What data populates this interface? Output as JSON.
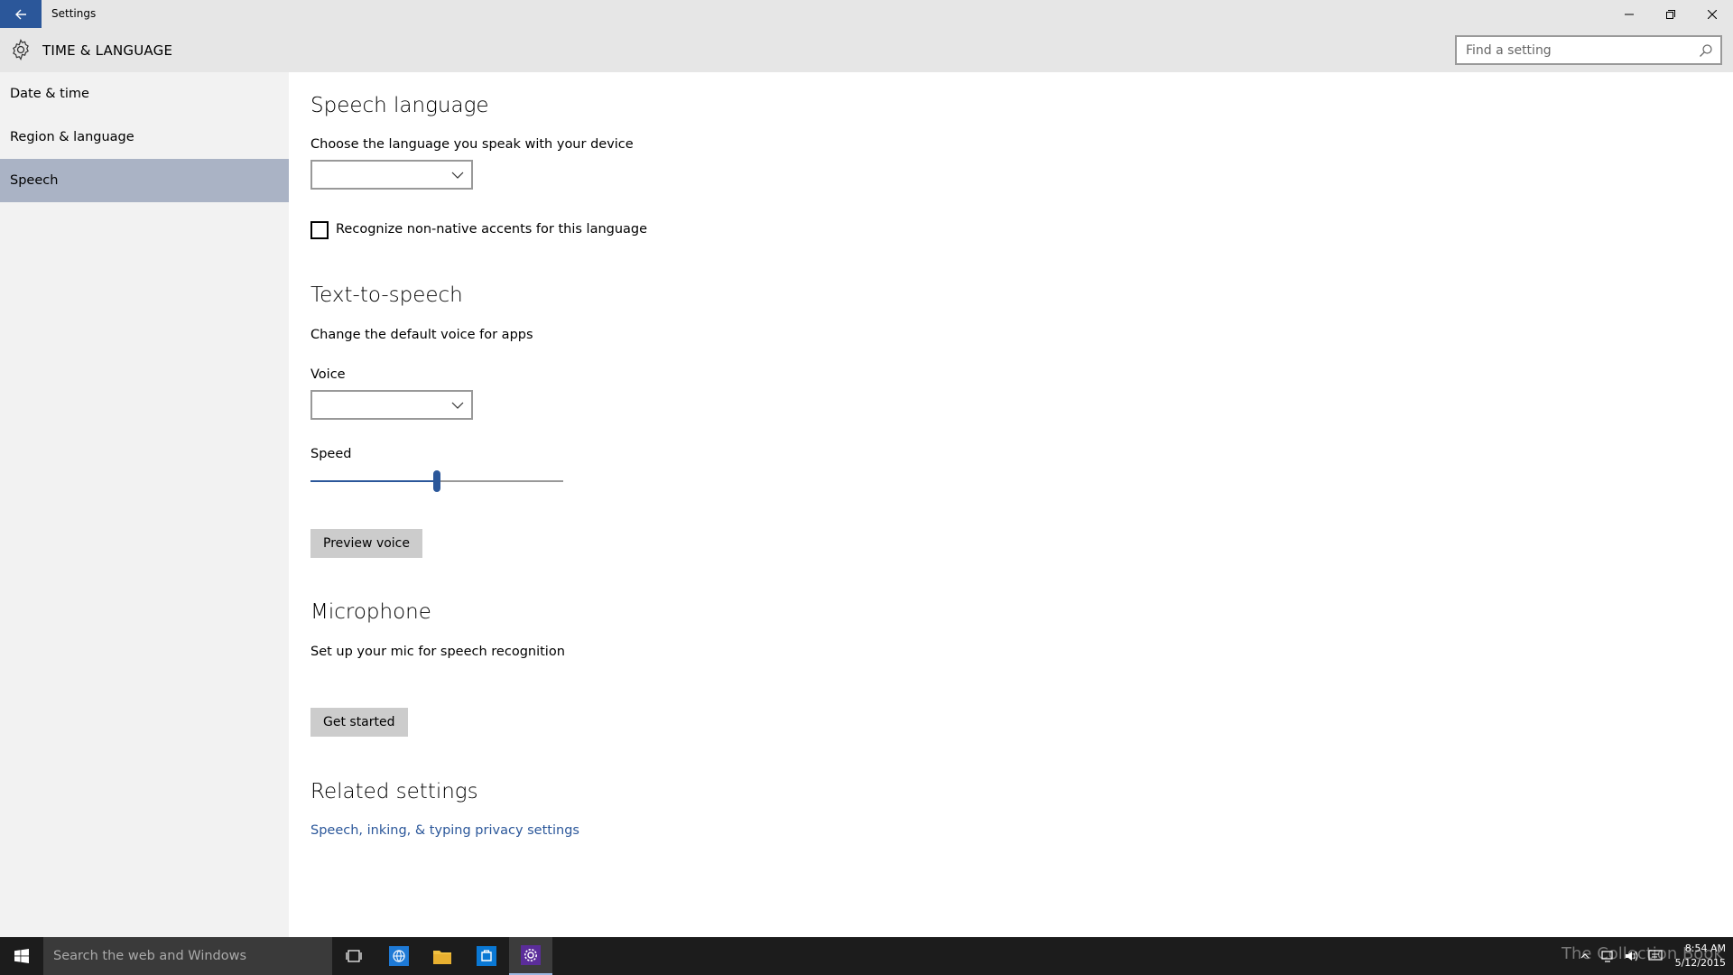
{
  "window": {
    "title": "Settings"
  },
  "header": {
    "category": "TIME & LANGUAGE",
    "search_placeholder": "Find a setting"
  },
  "sidebar": {
    "items": [
      {
        "label": "Date & time",
        "active": false
      },
      {
        "label": "Region & language",
        "active": false
      },
      {
        "label": "Speech",
        "active": true
      }
    ]
  },
  "content": {
    "speech_language": {
      "heading": "Speech language",
      "description": "Choose the language you speak with your device",
      "dropdown_value": "",
      "checkbox_label": "Recognize non-native accents for this language",
      "checkbox_checked": false
    },
    "tts": {
      "heading": "Text-to-speech",
      "description": "Change the default voice for apps",
      "voice_label": "Voice",
      "voice_value": "",
      "speed_label": "Speed",
      "speed_value": 0.5,
      "preview_button": "Preview voice"
    },
    "microphone": {
      "heading": "Microphone",
      "description": "Set up your mic for speech recognition",
      "button": "Get started"
    },
    "related": {
      "heading": "Related settings",
      "link": "Speech, inking, & typing privacy settings"
    }
  },
  "taskbar": {
    "search_text": "Search the web and Windows",
    "watermark": "The Collection Book",
    "time": "8:54 AM",
    "date": "5/12/2015"
  },
  "colors": {
    "accent": "#2b579a",
    "active_nav": "#aab3c5",
    "chrome": "#e6e6e6",
    "sidebar": "#f2f2f2",
    "taskbar": "#1c1c1c"
  }
}
